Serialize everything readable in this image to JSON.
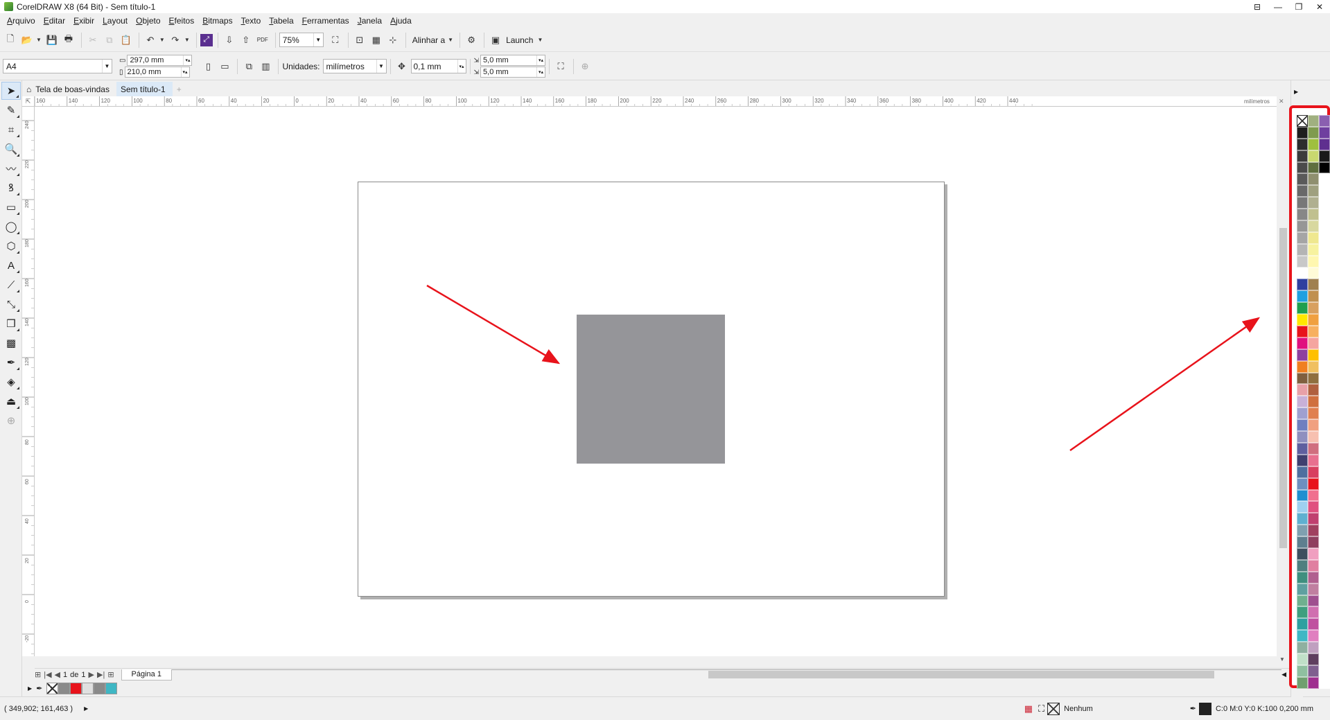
{
  "window": {
    "title": "CorelDRAW X8 (64 Bit) - Sem título-1"
  },
  "menu": [
    "Arquivo",
    "Editar",
    "Exibir",
    "Layout",
    "Objeto",
    "Efeitos",
    "Bitmaps",
    "Texto",
    "Tabela",
    "Ferramentas",
    "Janela",
    "Ajuda"
  ],
  "toolbar": {
    "zoom_value": "75%",
    "align_label": "Alinhar a",
    "launch_label": "Launch",
    "pdf_label": "PDF"
  },
  "props": {
    "page_size": "A4",
    "width": "297,0 mm",
    "height": "210,0 mm",
    "units_label": "Unidades:",
    "units_value": "milímetros",
    "nudge": "0,1 mm",
    "dup_x": "5,0 mm",
    "dup_y": "5,0 mm"
  },
  "tabs": {
    "welcome": "Tela de boas-vindas",
    "doc": "Sem título-1"
  },
  "ruler": {
    "unit": "milímetros",
    "h_ticks": [
      "160",
      "140",
      "120",
      "100",
      "80",
      "60",
      "40",
      "20",
      "0",
      "20",
      "40",
      "60",
      "80",
      "100",
      "120",
      "140",
      "160",
      "180",
      "200",
      "220",
      "240",
      "260",
      "280",
      "300",
      "320",
      "340",
      "360",
      "380",
      "400",
      "420",
      "440"
    ],
    "v_ticks": [
      "240",
      "220",
      "200",
      "180",
      "160",
      "140",
      "120",
      "100",
      "80",
      "60",
      "40",
      "20",
      "0",
      "-20"
    ]
  },
  "pagenav": {
    "current": "1",
    "of": "de",
    "total": "1",
    "page_tab": "Página 1"
  },
  "status": {
    "coords": "( 349,902; 161,463 )",
    "fill_label": "Nenhum",
    "outline": "C:0 M:0 Y:0 K:100  0,200 mm"
  },
  "colors": {
    "shape_fill": "#959599",
    "arrow": "#e8131b",
    "palette_highlight": "#e8131b"
  },
  "doc_palette": [
    "#ffffff",
    "#8a8a8a",
    "#e8131b",
    "#e0e0e0",
    "#8a8a8a",
    "#3fb7c4"
  ],
  "palette_swatches": [
    "none",
    "#a0b080",
    "#8a5fb0",
    "#1e1e1e",
    "#7f9b4f",
    "#6f3f9f",
    "#2d2d2d",
    "#9fc03f",
    "#5f2f8f",
    "#3c3c3c",
    "#c8d86f",
    "#1a1a1a",
    "#4b4b4b",
    "#5f6f3f",
    "#000000",
    "#5a5a5a",
    "#8f8f6f",
    "#ffffff",
    "#696969",
    "#9fa07f",
    "#ffffff",
    "#787878",
    "#b0b090",
    "#ffffff",
    "#878787",
    "#c0c08f",
    "#ffffff",
    "#969696",
    "#d8d89f",
    "#ffffff",
    "#a5a5a5",
    "#efe88f",
    "#ffffff",
    "#b4b4b4",
    "#f7f29f",
    "#ffffff",
    "#c8c8c8",
    "#fff7b0",
    "#ffffff",
    "#ffffff",
    "#fffbd8",
    "#ffffff",
    "#2f3f9f",
    "#a08050",
    "#ffffff",
    "#1fa0e0",
    "#c0904f",
    "#ffffff",
    "#1f9f4f",
    "#d8a05f",
    "#ffffff",
    "#ffe800",
    "#f0a040",
    "#ffffff",
    "#e8131b",
    "#f7b060",
    "#ffffff",
    "#e0107f",
    "#f5a5a0",
    "#ffffff",
    "#8f3f9f",
    "#ffc000",
    "#ffffff",
    "#f07f20",
    "#f0c060",
    "#ffffff",
    "#7f5f3f",
    "#8f6f3f",
    "#ffffff",
    "#e8a0a8",
    "#b0603f",
    "#ffffff",
    "#c8b0d8",
    "#d0703f",
    "#ffffff",
    "#9fa0d0",
    "#e08050",
    "#ffffff",
    "#6f7fc0",
    "#f0a080",
    "#ffffff",
    "#8f8fbf",
    "#f7c0b0",
    "#ffffff",
    "#5f5f9f",
    "#d06f7f",
    "#ffffff",
    "#3f3f6f",
    "#e8708f",
    "#ffffff",
    "#4f6f9f",
    "#d83f5f",
    "#ffffff",
    "#6f8fbf",
    "#e8131b",
    "#ffffff",
    "#1f8fd0",
    "#f0708f",
    "#ffffff",
    "#9fd0f0",
    "#e0507f",
    "#ffffff",
    "#5fb0d0",
    "#c0406f",
    "#ffffff",
    "#7fa0b0",
    "#a0405f",
    "#ffffff",
    "#5f7f8f",
    "#8f3f5f",
    "#ffffff",
    "#3f4f5f",
    "#f09fc0",
    "#ffffff",
    "#4f7f7f",
    "#e07fa0",
    "#ffffff",
    "#3f8f7f",
    "#b0608f",
    "#ffffff",
    "#5fa0a0",
    "#c07fa0",
    "#ffffff",
    "#6fb08f",
    "#9f4f8f",
    "#ffffff",
    "#3f9f7f",
    "#d06fb0",
    "#ffffff",
    "#2fa0a0",
    "#c050a0",
    "#ffffff",
    "#3fb7c4",
    "#e07fc0",
    "#ffffff",
    "#8fb0a0",
    "#c0a0c0",
    "#ffffff",
    "#c0e0c8",
    "#5f3f5f",
    "#ffffff",
    "#8fc0a0",
    "#7f5f8f",
    "#ffffff",
    "#6f9f6f",
    "#9f2f8f",
    "#ffffff"
  ]
}
